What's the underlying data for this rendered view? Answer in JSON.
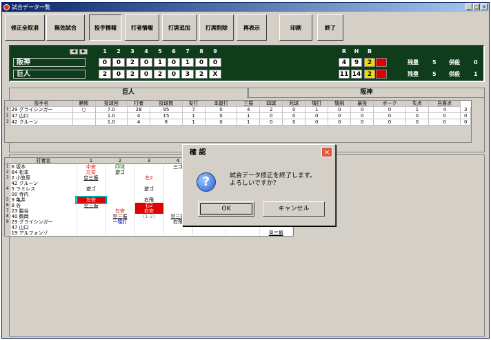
{
  "window": {
    "title": "試合データ一覧",
    "buttons": [
      "_",
      "□",
      "×"
    ]
  },
  "toolbar": [
    {
      "label": "修正全取消",
      "selected": false
    },
    {
      "label": "無効試合",
      "selected": false
    },
    {
      "label": "投手情報",
      "selected": true
    },
    {
      "label": "打者情報",
      "selected": false
    },
    {
      "label": "打席追加",
      "selected": false
    },
    {
      "label": "打席削除",
      "selected": false
    },
    {
      "label": "再表示",
      "selected": false
    },
    {
      "label": "印刷",
      "selected": false
    },
    {
      "label": "終了",
      "selected": false
    }
  ],
  "scoreboard": {
    "nav": [
      "◀",
      "▶"
    ],
    "innings": [
      "1",
      "2",
      "3",
      "4",
      "5",
      "6",
      "7",
      "8",
      "9"
    ],
    "totals_header": [
      "R",
      "H",
      "B",
      ""
    ],
    "teams": [
      {
        "name": "阪神",
        "scores": [
          "0",
          "0",
          "2",
          "0",
          "1",
          "0",
          "1",
          "0",
          "0"
        ],
        "R": "4",
        "H": "9",
        "B": "2",
        "E": "",
        "zan_label": "残塁",
        "zan": "5",
        "heisatsu_label": "併殺",
        "heisatsu": "0"
      },
      {
        "name": "巨人",
        "scores": [
          "2",
          "0",
          "2",
          "0",
          "2",
          "0",
          "3",
          "2",
          "X"
        ],
        "R": "11",
        "H": "14",
        "B": "2",
        "E": "",
        "zan_label": "残塁",
        "zan": "5",
        "heisatsu_label": "併殺",
        "heisatsu": "1"
      }
    ]
  },
  "tabs": [
    {
      "label": "巨人",
      "active": true
    },
    {
      "label": "阪神",
      "active": false
    }
  ],
  "pitcher_table": {
    "headers": [
      "投手名",
      "勝敗",
      "投球回",
      "打者",
      "投球数",
      "安打",
      "本塁打",
      "三振",
      "四球",
      "死球",
      "犠打",
      "犠飛",
      "暴投",
      "ボーク",
      "失点",
      "自責点"
    ],
    "rows": [
      {
        "no": "1",
        "name": "29 グライシンガー",
        "cells": [
          "○",
          "7.0",
          "28",
          "95",
          "7",
          "0",
          "4",
          "2",
          "0",
          "1",
          "0",
          "0",
          "0",
          "1",
          "4",
          "3"
        ]
      },
      {
        "no": "2",
        "name": "47 山口",
        "cells": [
          "",
          "1.0",
          "4",
          "15",
          "1",
          "0",
          "1",
          "0",
          "0",
          "0",
          "0",
          "0",
          "0",
          "0",
          "0",
          "0"
        ]
      },
      {
        "no": "3",
        "name": "42 クルーン",
        "cells": [
          "",
          "1.0",
          "4",
          "8",
          "1",
          "0",
          "1",
          "0",
          "0",
          "0",
          "0",
          "0",
          "0",
          "0",
          "0",
          "0"
        ]
      }
    ]
  },
  "batter_table": {
    "headers": [
      "打者名",
      "1",
      "2",
      "3",
      "4"
    ],
    "rows": [
      {
        "no": "1",
        "name": "6 坂本",
        "cells": [
          {
            "t": "中安",
            "c": "red"
          },
          {
            "t": "四球",
            "c": "green"
          },
          {
            "t": "",
            "c": ""
          },
          {
            "t": "三ゴ",
            "c": ""
          }
        ],
        "extra": []
      },
      {
        "no": "2",
        "name": "64 松本",
        "cells": [
          {
            "t": "左安",
            "c": "red"
          },
          {
            "t": "遊ゴ",
            "c": ""
          },
          {
            "t": "",
            "c": ""
          },
          {
            "t": "",
            "c": ""
          }
        ],
        "extra": []
      },
      {
        "no": "3",
        "name": "2 小笠原",
        "cells": [
          {
            "t": "空三振",
            "c": "ul"
          },
          {
            "t": "",
            "c": ""
          },
          {
            "t": "左2",
            "c": "red"
          },
          {
            "t": "",
            "c": ""
          }
        ],
        "extra": []
      },
      {
        "no": "",
        "name": "42 クルーン",
        "cells": [
          {
            "t": "",
            "c": ""
          },
          {
            "t": "",
            "c": ""
          },
          {
            "t": "",
            "c": ""
          },
          {
            "t": "",
            "c": ""
          }
        ],
        "extra": []
      },
      {
        "no": "4",
        "name": "5 ラミレス",
        "cells": [
          {
            "t": "遊ゴ",
            "c": ""
          },
          {
            "t": "",
            "c": ""
          },
          {
            "t": "遊ゴ",
            "c": ""
          },
          {
            "t": "",
            "c": ""
          }
        ],
        "extra": []
      },
      {
        "no": "",
        "name": "00 寺内",
        "cells": [
          {
            "t": "",
            "c": ""
          },
          {
            "t": "",
            "c": ""
          },
          {
            "t": "",
            "c": ""
          },
          {
            "t": "",
            "c": ""
          }
        ],
        "extra": []
      },
      {
        "no": "5",
        "name": "9 亀井",
        "cells": [
          {
            "t": "左安",
            "c": "boxed"
          },
          {
            "t": "",
            "c": ""
          },
          {
            "t": "右飛",
            "c": ""
          },
          {
            "t": "",
            "c": ""
          }
        ],
        "extra": []
      },
      {
        "no": "6",
        "name": "8 谷",
        "cells": [
          {
            "t": "空三振",
            "c": "ul"
          },
          {
            "t": "",
            "c": ""
          },
          {
            "t": "右2",
            "c": "bgred"
          },
          {
            "t": "",
            "c": ""
          }
        ],
        "extra": [
          {
            "t": "遊飛",
            "c": ""
          },
          {
            "t": "四球",
            "c": "green"
          }
        ]
      },
      {
        "no": "7",
        "name": "23 脇谷",
        "cells": [
          {
            "t": "",
            "c": ""
          },
          {
            "t": "左安",
            "c": "red"
          },
          {
            "t": "右安",
            "c": "bgred"
          },
          {
            "t": "",
            "c": ""
          }
        ],
        "extra": [
          {
            "t": "",
            "c": ""
          },
          {
            "t": "空三振",
            "c": "ul"
          },
          {
            "t": "遊飛",
            "c": ""
          }
        ]
      },
      {
        "no": "8",
        "name": "40 鶴岡",
        "cells": [
          {
            "t": "",
            "c": ""
          },
          {
            "t": "空三振",
            "c": "ul"
          },
          {
            "t": "(1-2)",
            "c": "gray"
          },
          {
            "t": "空三振",
            "c": "ul"
          }
        ],
        "extra": [
          {
            "t": "見三振",
            "c": "ul"
          },
          {
            "t": "",
            "c": ""
          },
          {
            "t": "捕邪",
            "c": ""
          }
        ]
      },
      {
        "no": "9",
        "name": "29 グライシンガー",
        "cells": [
          {
            "t": "",
            "c": ""
          },
          {
            "t": "一犠打",
            "c": "blue"
          },
          {
            "t": "",
            "c": ""
          },
          {
            "t": "右飛",
            "c": ""
          }
        ],
        "extra": [
          {
            "t": "遊ゴ",
            "c": ""
          }
        ]
      },
      {
        "no": "",
        "name": "47 山口",
        "cells": [
          {
            "t": "",
            "c": ""
          },
          {
            "t": "",
            "c": ""
          },
          {
            "t": "",
            "c": ""
          },
          {
            "t": "",
            "c": ""
          }
        ],
        "extra": []
      },
      {
        "no": "",
        "name": "19 アルフォンゾ",
        "cells": [
          {
            "t": "",
            "c": ""
          },
          {
            "t": "",
            "c": ""
          },
          {
            "t": "",
            "c": ""
          },
          {
            "t": "",
            "c": ""
          }
        ],
        "extra": [
          {
            "t": "",
            "c": ""
          },
          {
            "t": "",
            "c": ""
          },
          {
            "t": "見三振",
            "c": "ul"
          }
        ]
      }
    ]
  },
  "dialog": {
    "title": "確 認",
    "close": "×",
    "icon": "question-icon",
    "icon_glyph": "?",
    "message_line1": "試合データ修正を終了します。",
    "message_line2": "よろしいですか？",
    "ok_label": "OK",
    "cancel_label": "キャンセル"
  }
}
